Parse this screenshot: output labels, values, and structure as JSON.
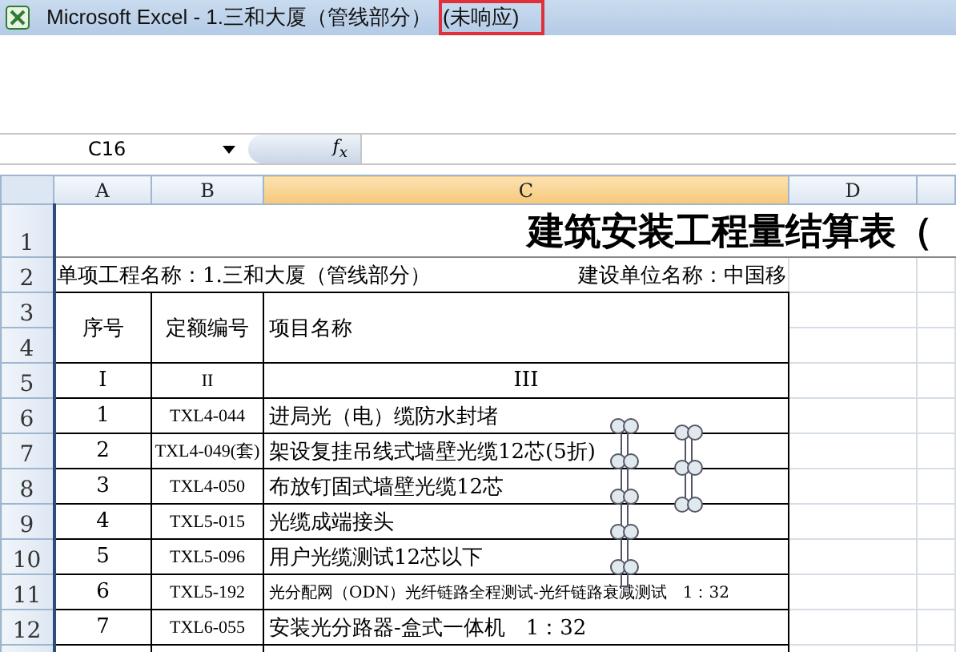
{
  "window": {
    "title": "Microsoft Excel - 1.三和大厦（管线部分）",
    "status": "(未响应)"
  },
  "formula_bar": {
    "name_box": "C16",
    "fx": "f$_{x}$"
  },
  "columns": [
    {
      "label": "A",
      "selected": false
    },
    {
      "label": "B",
      "selected": false
    },
    {
      "label": "C",
      "selected": true
    },
    {
      "label": "D",
      "selected": false
    }
  ],
  "rows": [
    {
      "number": "1",
      "cells": [
        {
          "kind": "title",
          "text": "建筑安装工程量结算表（"
        }
      ]
    },
    {
      "number": "2",
      "cells": [
        {
          "kind": "info",
          "text": "单项工程名称：1.三和大厦（管线部分）",
          "text_right": "建设单位名称：中国移"
        }
      ]
    },
    {
      "number": "3",
      "cells": [
        {
          "kind": "head",
          "text": "序号"
        },
        {
          "kind": "head",
          "text": "定额编号"
        },
        {
          "kind": "head_left",
          "text": "项目名称"
        }
      ]
    },
    {
      "number": "4",
      "cells": []
    },
    {
      "number": "5",
      "cells": [
        {
          "kind": "center",
          "text": "I"
        },
        {
          "kind": "center",
          "text": "II"
        },
        {
          "kind": "center",
          "text": "III"
        }
      ]
    },
    {
      "number": "6",
      "cells": [
        {
          "kind": "center",
          "text": "1"
        },
        {
          "kind": "center",
          "text": "TXL4-044"
        },
        {
          "kind": "left",
          "text": "进局光（电）缆防水封堵"
        }
      ]
    },
    {
      "number": "7",
      "cells": [
        {
          "kind": "center",
          "text": "2"
        },
        {
          "kind": "center",
          "text": "TXL4-049(套)"
        },
        {
          "kind": "left",
          "text": "架设复挂吊线式墙壁光缆12芯(5折)"
        }
      ]
    },
    {
      "number": "8",
      "cells": [
        {
          "kind": "center",
          "text": "3"
        },
        {
          "kind": "center",
          "text": "TXL4-050"
        },
        {
          "kind": "left",
          "text": "布放钉固式墙壁光缆12芯"
        }
      ]
    },
    {
      "number": "9",
      "cells": [
        {
          "kind": "center",
          "text": "4"
        },
        {
          "kind": "center",
          "text": "TXL5-015"
        },
        {
          "kind": "left",
          "text": "光缆成端接头"
        }
      ]
    },
    {
      "number": "10",
      "cells": [
        {
          "kind": "center",
          "text": "5"
        },
        {
          "kind": "center",
          "text": "TXL5-096"
        },
        {
          "kind": "left",
          "text": "用户光缆测试12芯以下"
        }
      ]
    },
    {
      "number": "11",
      "cells": [
        {
          "kind": "center",
          "text": "6"
        },
        {
          "kind": "center",
          "text": "TXL5-192"
        },
        {
          "kind": "small",
          "text": "光分配网（ODN）光纤链路全程测试-光纤链路衰减测试　1：32"
        }
      ]
    },
    {
      "number": "12",
      "cells": [
        {
          "kind": "center",
          "text": "7"
        },
        {
          "kind": "center",
          "text": "TXL6-055"
        },
        {
          "kind": "left",
          "text": "安装光分路器-盒式一体机　1：32"
        }
      ]
    }
  ]
}
